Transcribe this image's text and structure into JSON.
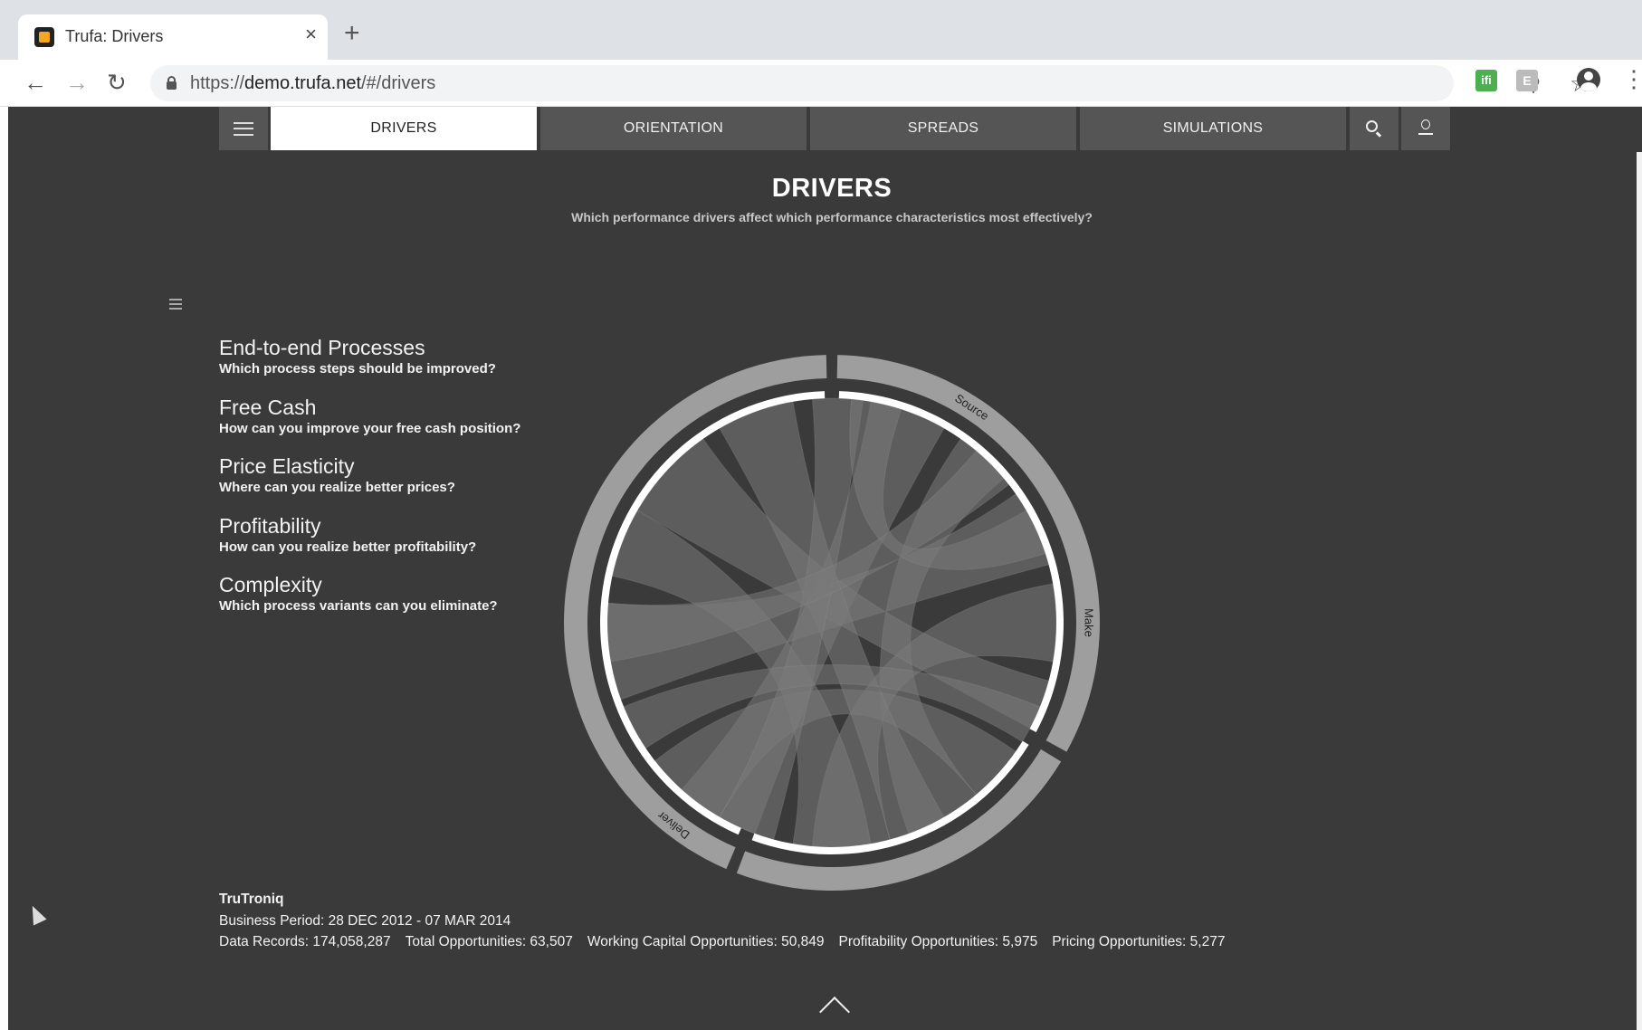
{
  "browser": {
    "tab_title": "Trufa: Drivers",
    "tab_close": "×",
    "new_tab": "+",
    "url_scheme": "https://",
    "url_host": "demo.trufa.net",
    "url_path": "/#/drivers",
    "ext_ifttt": "ifi",
    "ext_e": "E"
  },
  "nav": {
    "tabs": [
      {
        "label": "DRIVERS",
        "active": true
      },
      {
        "label": "ORIENTATION",
        "active": false
      },
      {
        "label": "SPREADS",
        "active": false
      },
      {
        "label": "SIMULATIONS",
        "active": false
      }
    ]
  },
  "page": {
    "title": "DRIVERS",
    "subtitle": "Which performance drivers affect which performance characteristics most effectively?"
  },
  "questions": [
    {
      "title": "End-to-end Processes",
      "subtitle": "Which process steps should be improved?"
    },
    {
      "title": "Free Cash",
      "subtitle": "How can you improve your free cash position?"
    },
    {
      "title": "Price Elasticity",
      "subtitle": "Where can you realize better prices?"
    },
    {
      "title": "Profitability",
      "subtitle": "How can you realize better profitability?"
    },
    {
      "title": "Complexity",
      "subtitle": "Which process variants can you eliminate?"
    }
  ],
  "chart_data": {
    "type": "chord",
    "groups": [
      {
        "label": "Source",
        "arc_deg": [
          0,
          120
        ]
      },
      {
        "label": "Make",
        "arc_deg": [
          120,
          202
        ]
      },
      {
        "label": "Deliver",
        "arc_deg": [
          202,
          360
        ]
      }
    ],
    "colors": {
      "outer_ring": "#9e9e9e",
      "inner_ring": "#ffffff",
      "ribbon": "#7a7a7a",
      "background": "#3a3a3a"
    }
  },
  "footer": {
    "company": "TruTroniq",
    "period": "Business Period: 28 DEC 2012 - 07 MAR 2014",
    "stats": [
      "Data Records: 174,058,287",
      "Total Opportunities: 63,507",
      "Working Capital Opportunities: 50,849",
      "Profitability Opportunities: 5,975",
      "Pricing Opportunities: 5,277"
    ]
  }
}
